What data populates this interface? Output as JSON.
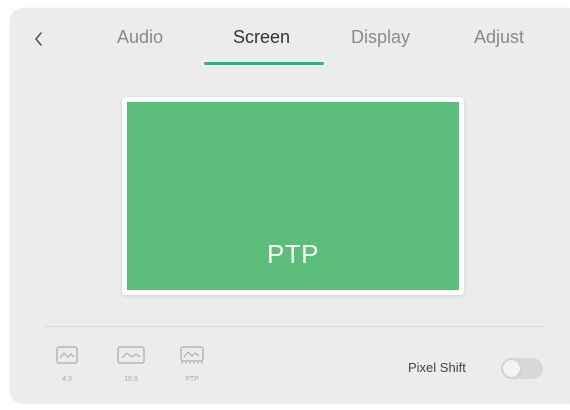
{
  "tabs": [
    {
      "label": "Audio",
      "active": false
    },
    {
      "label": "Screen",
      "active": true
    },
    {
      "label": "Display",
      "active": false
    },
    {
      "label": "Adjust",
      "active": false
    }
  ],
  "preview": {
    "label": "PTP",
    "color": "#5dbd7b"
  },
  "aspect_modes": [
    {
      "label": "4:3",
      "icon": "landscape-image-icon"
    },
    {
      "label": "16:9",
      "icon": "landscape-image-icon"
    },
    {
      "label": "PTP",
      "icon": "landscape-image-icon"
    }
  ],
  "pixel_shift": {
    "label": "Pixel Shift",
    "enabled": false
  },
  "colors": {
    "accent": "#3aa991",
    "panel_bg": "#ececec"
  }
}
